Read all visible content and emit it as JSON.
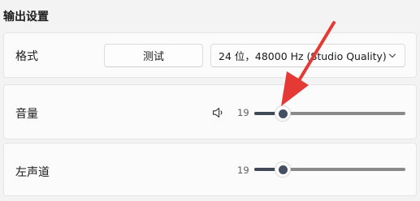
{
  "section": {
    "title": "输出设置"
  },
  "format_row": {
    "label": "格式",
    "test_button": "测试",
    "select_value": "24 位，48000 Hz (Studio Quality)"
  },
  "volume_row": {
    "label": "音量",
    "icon": "speaker-icon",
    "value_text": "19",
    "level_percent": 19
  },
  "left_channel_row": {
    "label": "左声道",
    "value_text": "19",
    "level_percent": 19
  },
  "colors": {
    "accent": "#404a56",
    "arrow": "#e53935"
  }
}
